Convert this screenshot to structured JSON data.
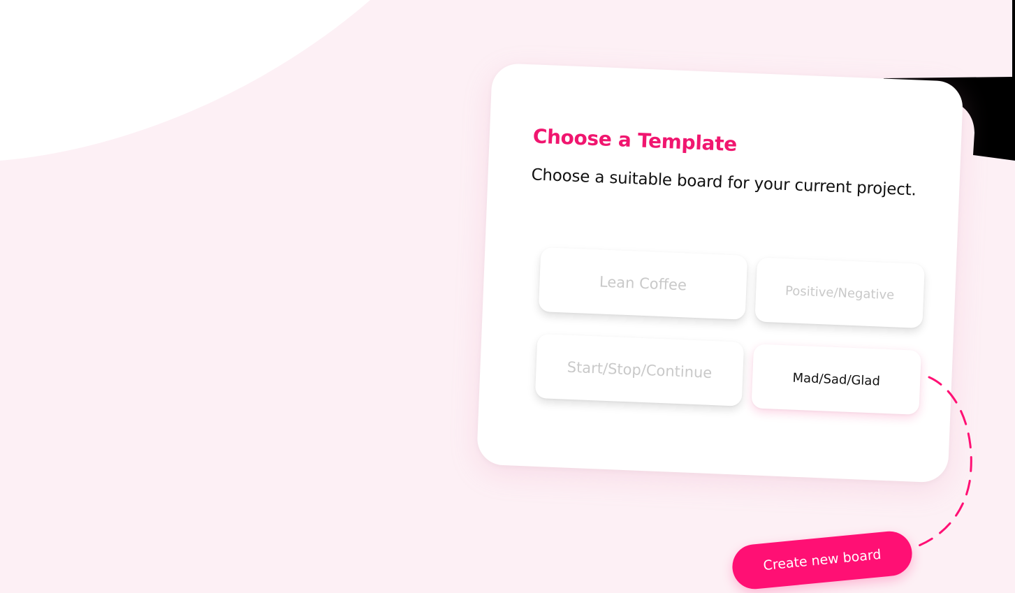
{
  "card": {
    "title": "Choose a Template",
    "subtitle": "Choose a suitable board for your current project."
  },
  "templates": [
    {
      "label": "Lean Coffee",
      "selected": false
    },
    {
      "label": "Positive/Negative",
      "selected": false
    },
    {
      "label": "Start/Stop/Continue",
      "selected": false
    },
    {
      "label": "Mad/Sad/Glad",
      "selected": true
    }
  ],
  "create_button": {
    "label": "Create new board"
  },
  "colors": {
    "accent": "#ff1074",
    "title": "#f0166f",
    "background_blob": "#fdf0f5",
    "muted_text": "#c9c9c9",
    "dark_text": "#111111"
  }
}
